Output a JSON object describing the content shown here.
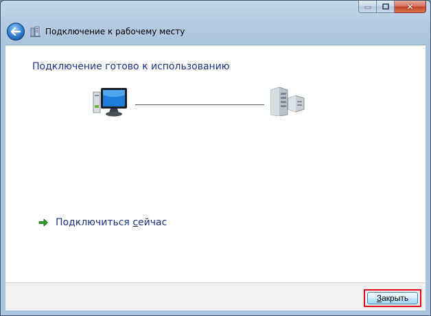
{
  "window": {
    "title": "Подключение к рабочему месту",
    "caption": {
      "minimize_icon": "minimize-icon",
      "maximize_icon": "maximize-icon",
      "close_icon": "close-icon",
      "close_glyph": "✕"
    }
  },
  "content": {
    "heading": "Подключение готово к использованию",
    "connect_link": {
      "prefix": "Подключиться ",
      "mnemonic": "с",
      "suffix": "ейчас"
    }
  },
  "footer": {
    "close_button": {
      "mnemonic": "З",
      "suffix": "акрыть"
    }
  },
  "colors": {
    "link": "#1e3287",
    "highlight": "#e0001a",
    "arrow": "#2da02d"
  }
}
